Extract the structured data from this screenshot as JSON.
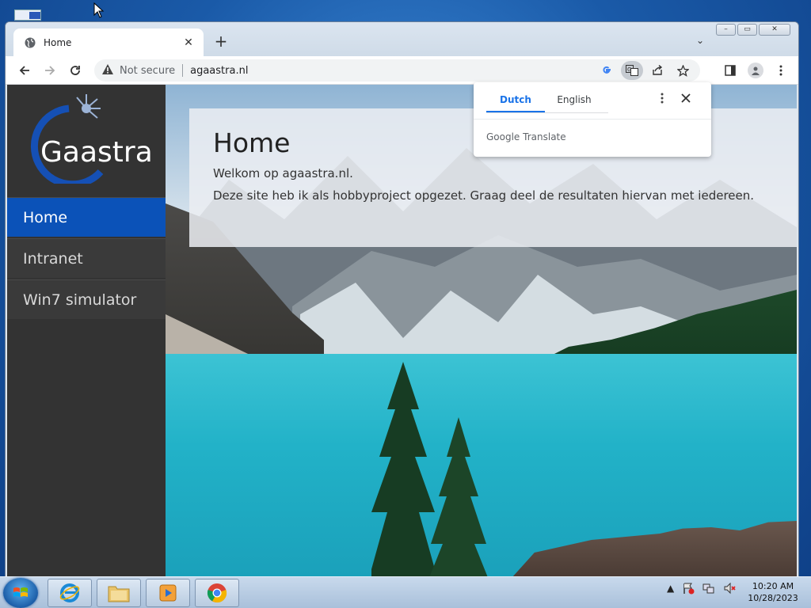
{
  "browser": {
    "tab_title": "Home",
    "new_tab": "+",
    "tab_close": "✕",
    "tab_search": "⌄",
    "security_label": "Not secure",
    "url": "agaastra.nl"
  },
  "window_controls": {
    "minimize": "–",
    "maximize": "▭",
    "close": "✕"
  },
  "translate_popup": {
    "tabs": [
      "Dutch",
      "English"
    ],
    "active_tab": 0,
    "brand": "Google",
    "brand_suffix": "Translate"
  },
  "site": {
    "logo_text": "Gaastra",
    "nav": [
      {
        "label": "Home",
        "active": true
      },
      {
        "label": "Intranet",
        "active": false
      },
      {
        "label": "Win7 simulator",
        "active": false
      }
    ],
    "heading": "Home",
    "paragraphs": [
      "Welkom op agaastra.nl.",
      "Deze site heb ik als hobbyproject opgezet. Graag deel de resultaten hiervan met iedereen."
    ]
  },
  "taskbar": {
    "time": "10:20 AM",
    "date": "10/28/2023"
  },
  "colors": {
    "accent": "#0b52b8",
    "sidebar": "#333333",
    "translate_blue": "#1a73e8"
  }
}
